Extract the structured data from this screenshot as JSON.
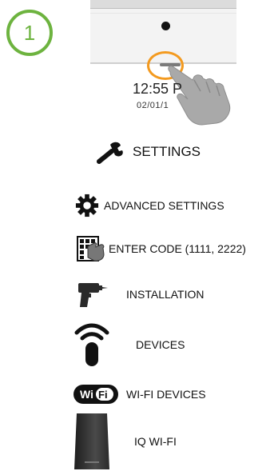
{
  "step_number": "1",
  "lock_screen": {
    "time": "12:55 P",
    "date": "02/01/1"
  },
  "menu": {
    "settings": "SETTINGS",
    "advanced_settings": "ADVANCED SETTINGS",
    "enter_code": "ENTER CODE (1111, 2222)",
    "installation": "INSTALLATION",
    "devices": "DEVICES",
    "wifi_devices": "WI-FI DEVICES",
    "iq_wifi": "IQ WI-FI"
  },
  "colors": {
    "badge": "#6db33f",
    "highlight_ring": "#f39a1f"
  },
  "icons": [
    "wrench-icon",
    "gear-icon",
    "keypad-hand-icon",
    "drill-icon",
    "wifi-remote-icon",
    "wifi-badge-icon",
    "router-icon",
    "hand-pointer-icon",
    "camera-icon"
  ]
}
